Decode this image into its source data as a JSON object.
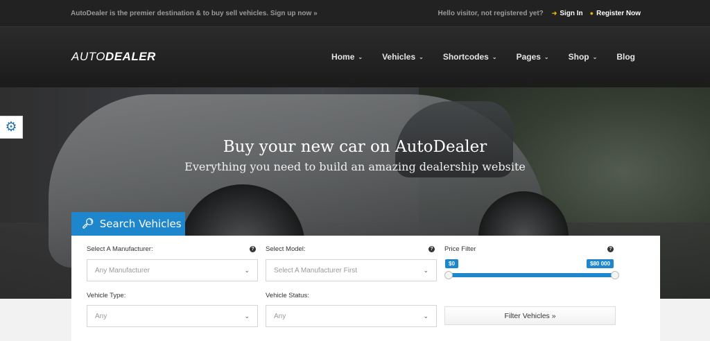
{
  "topbar": {
    "promo": "AutoDealer is the premier destination & to buy sell vehicles. Sign up now »",
    "hello": "Hello visitor, not registered yet?",
    "sign_in": "Sign In",
    "register": "Register Now",
    "sign_in_icon": "sign-in-icon",
    "register_icon": "user-icon"
  },
  "header": {
    "logo_auto": "AUTO",
    "logo_dealer": "DEALER",
    "nav": [
      {
        "label": "Home",
        "dropdown": true
      },
      {
        "label": "Vehicles",
        "dropdown": true
      },
      {
        "label": "Shortcodes",
        "dropdown": true
      },
      {
        "label": "Pages",
        "dropdown": true
      },
      {
        "label": "Shop",
        "dropdown": true
      },
      {
        "label": "Blog",
        "dropdown": false
      }
    ]
  },
  "hero": {
    "title": "Buy your new car on AutoDealer",
    "subtitle": "Everything you need to build an amazing dealership website"
  },
  "search": {
    "tab_label": "Search Vehicles",
    "manufacturer_label": "Select A Manufacturer:",
    "manufacturer_value": "Any Manufacturer",
    "model_label": "Select Model:",
    "model_value": "Select A Manufacturer First",
    "price_label": "Price Filter",
    "price_min": "$0",
    "price_max": "$80 000",
    "price_range_fraction": [
      0,
      1
    ],
    "type_label": "Vehicle Type:",
    "type_value": "Any",
    "status_label": "Vehicle Status:",
    "status_value": "Any",
    "filter_button": "Filter Vehicles »",
    "help_glyph": "?"
  },
  "colors": {
    "accent": "#1e86cd",
    "topbar_bg": "#222222",
    "header_bg": "#1f1f1f",
    "icon_yellow": "#e7b400"
  }
}
